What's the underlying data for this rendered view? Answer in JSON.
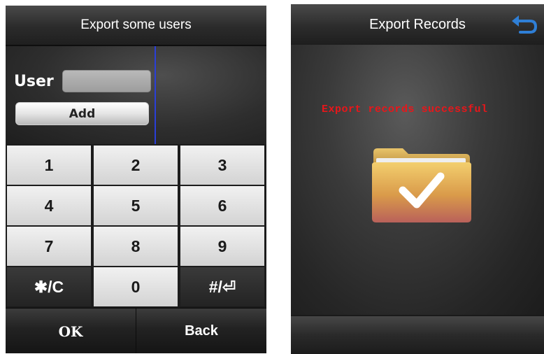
{
  "left_screen": {
    "title": "Export some users",
    "form": {
      "user_label": "User",
      "user_value": "",
      "add_label": "Add"
    },
    "keypad": {
      "keys": [
        {
          "label": "1",
          "style": "light"
        },
        {
          "label": "2",
          "style": "light"
        },
        {
          "label": "3",
          "style": "light"
        },
        {
          "label": "4",
          "style": "light"
        },
        {
          "label": "5",
          "style": "light"
        },
        {
          "label": "6",
          "style": "light"
        },
        {
          "label": "7",
          "style": "light"
        },
        {
          "label": "8",
          "style": "light"
        },
        {
          "label": "9",
          "style": "light"
        },
        {
          "label": "✱/C",
          "style": "dark"
        },
        {
          "label": "0",
          "style": "light"
        },
        {
          "label": "#/⏎",
          "style": "dark"
        }
      ]
    },
    "bottom": {
      "ok_label": "OK",
      "back_label": "Back"
    }
  },
  "right_screen": {
    "title": "Export Records",
    "return_icon": "return-arrow-icon",
    "message": "Export records successful",
    "folder_icon": "folder-check-icon",
    "colors": {
      "message": "#e8161a",
      "return_icon": "#2f7fd6"
    }
  }
}
